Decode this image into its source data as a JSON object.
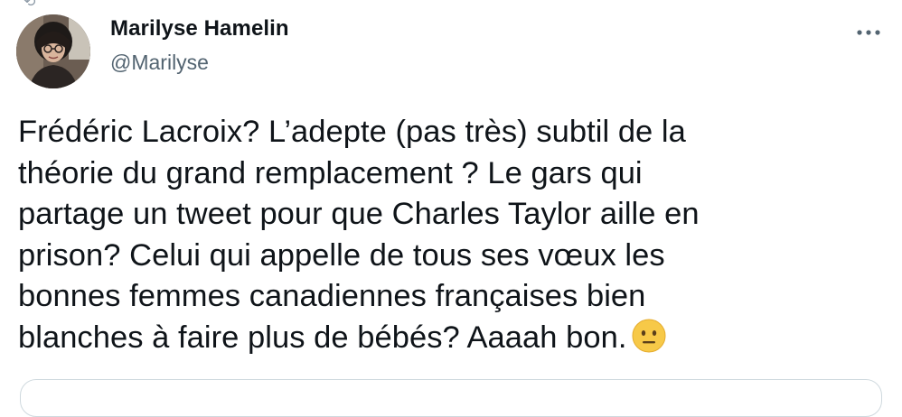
{
  "author": {
    "name": "Marilyse Hamelin",
    "handle": "@Marilyse"
  },
  "icons": {
    "more": "more-horizontal-icon",
    "emoji": "neutral-face-emoji"
  },
  "tweet": {
    "lines": [
      "Frédéric Lacroix? L’adepte (pas très) subtil de la",
      "théorie du grand remplacement ? Le gars qui",
      "partage un tweet pour que Charles Taylor aille en",
      "prison? Celui qui appelle de tous ses vœux les",
      "bonnes femmes canadiennes françaises bien",
      "blanches à faire plus de bébés? Aaaah bon."
    ]
  },
  "colors": {
    "text": "#0f1419",
    "secondary": "#536471",
    "border": "#cfd9de",
    "emoji": "#f7c948"
  }
}
